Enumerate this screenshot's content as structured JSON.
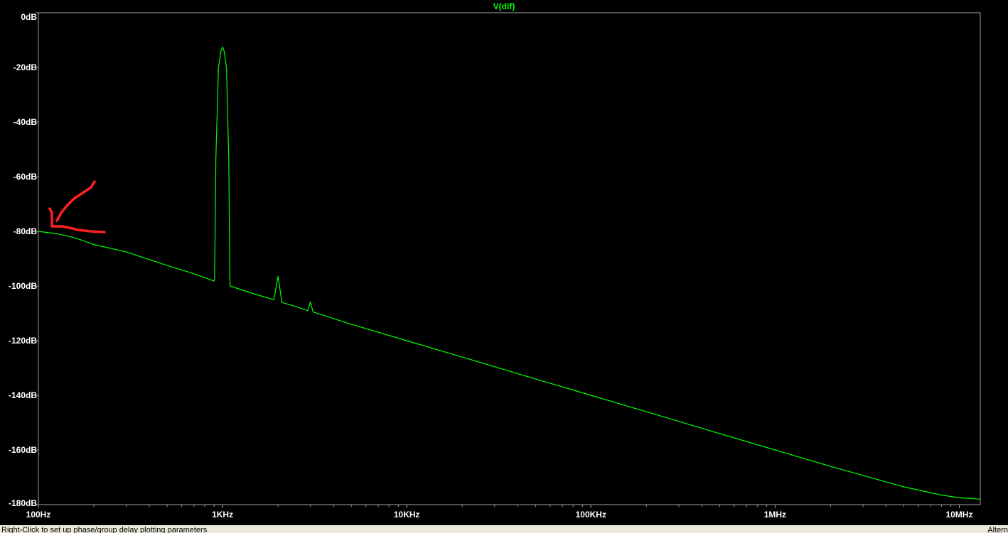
{
  "chart_data": {
    "type": "line",
    "title": "V(dif)",
    "xscale": "log",
    "xlim": [
      100,
      13000000
    ],
    "ylim": [
      -180,
      0
    ],
    "grid": false,
    "y_ticks": [
      "0dB",
      "-20dB",
      "-40dB",
      "-60dB",
      "-80dB",
      "-100dB",
      "-120dB",
      "-140dB",
      "-160dB",
      "-180dB"
    ],
    "x_ticks": [
      "100Hz",
      "1KHz",
      "10KHz",
      "100KHz",
      "1MHz",
      "10MHz"
    ],
    "series": [
      {
        "name": "V(dif)",
        "color": "#00ff00",
        "x": [
          100,
          130,
          160,
          200,
          300,
          500,
          700,
          900,
          905,
          920,
          950,
          980,
          1000,
          1020,
          1050,
          1080,
          1095,
          1100,
          1500,
          1900,
          2000,
          2100,
          2500,
          2900,
          3000,
          3100,
          5000,
          10000,
          20000,
          50000,
          100000,
          200000,
          500000,
          1000000,
          2000000,
          5000000,
          8000000,
          10000000,
          13000000
        ],
        "y": [
          -80,
          -81,
          -82.5,
          -84.8,
          -87.5,
          -92.5,
          -95.5,
          -98.2,
          -97,
          -53,
          -20,
          -14,
          -12.5,
          -14,
          -20,
          -53,
          -97,
          -100,
          -103,
          -105,
          -96.5,
          -106,
          -107.5,
          -109,
          -105.8,
          -109.5,
          -114,
          -120,
          -126,
          -134,
          -140,
          -146,
          -154,
          -160,
          -166,
          -173.5,
          -176.5,
          -177.5,
          -178
        ]
      }
    ],
    "annotations": [
      {
        "type": "freehand-mark",
        "color": "#ff2020"
      }
    ]
  },
  "status": {
    "left": "Right-Click to set up phase/group delay plotting parameters",
    "right": "Altern"
  },
  "colors": {
    "background": "#000000",
    "trace": "#00ff00",
    "axis_text": "#ffffff",
    "frame": "#a0a0a0",
    "annotation": "#ff2020"
  }
}
